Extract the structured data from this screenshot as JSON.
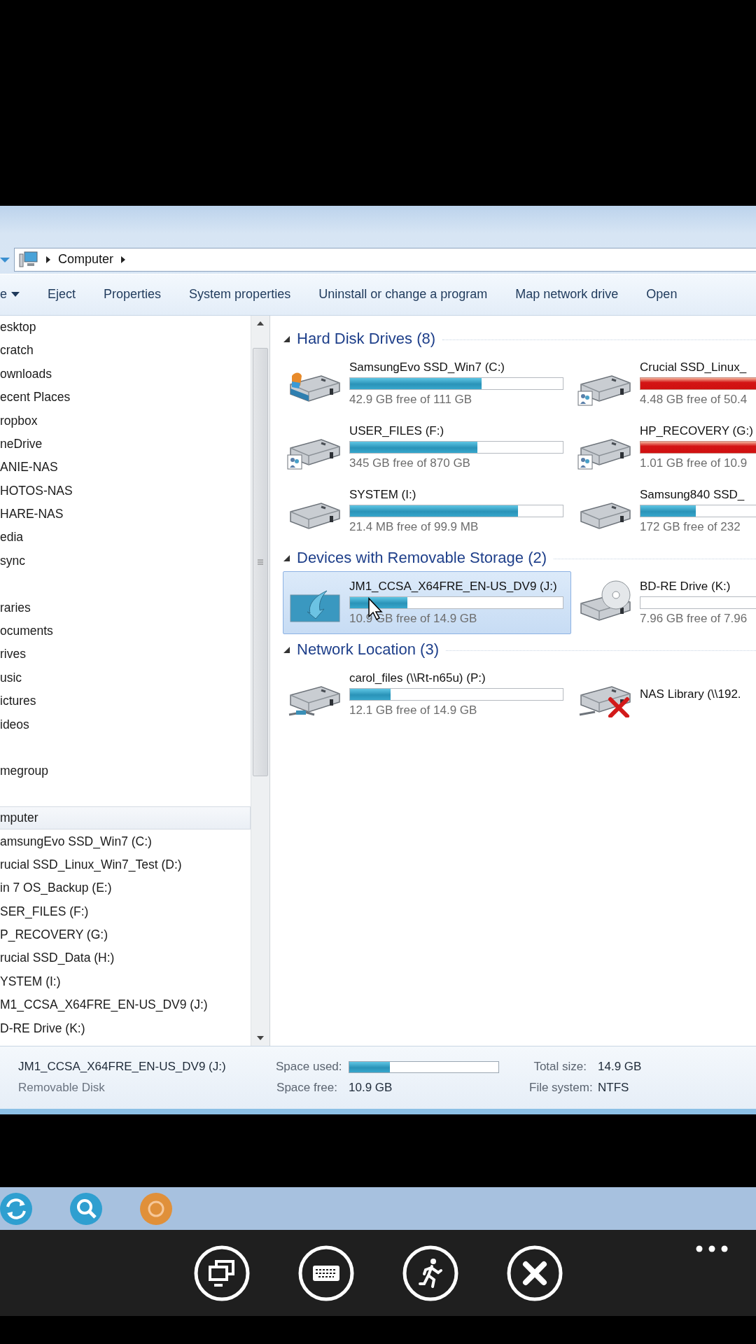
{
  "address_bar": {
    "location": "Computer"
  },
  "toolbar": {
    "items": [
      {
        "label": "e",
        "kind": "menu"
      },
      {
        "label": "Eject",
        "kind": "button"
      },
      {
        "label": "Properties",
        "kind": "button"
      },
      {
        "label": "System properties",
        "kind": "button"
      },
      {
        "label": "Uninstall or change a program",
        "kind": "button"
      },
      {
        "label": "Map network drive",
        "kind": "button"
      },
      {
        "label": "Open",
        "kind": "button"
      }
    ]
  },
  "navigation": {
    "groups": [
      {
        "items": [
          {
            "label": "esktop",
            "selected": false
          },
          {
            "label": "cratch",
            "selected": false
          },
          {
            "label": "ownloads",
            "selected": false
          },
          {
            "label": "ecent Places",
            "selected": false
          },
          {
            "label": "ropbox",
            "selected": false
          },
          {
            "label": "neDrive",
            "selected": false
          },
          {
            "label": "ANIE-NAS",
            "selected": false
          },
          {
            "label": "HOTOS-NAS",
            "selected": false
          },
          {
            "label": "HARE-NAS",
            "selected": false
          },
          {
            "label": "edia",
            "selected": false
          },
          {
            "label": "sync",
            "selected": false
          }
        ]
      },
      {
        "items": [
          {
            "label": "raries",
            "selected": false
          },
          {
            "label": "ocuments",
            "selected": false
          },
          {
            "label": "rives",
            "selected": false
          },
          {
            "label": "usic",
            "selected": false
          },
          {
            "label": "ictures",
            "selected": false
          },
          {
            "label": "ideos",
            "selected": false
          }
        ]
      },
      {
        "items": [
          {
            "label": "megroup",
            "selected": false
          }
        ]
      },
      {
        "items": [
          {
            "label": "mputer",
            "selected": true
          },
          {
            "label": "amsungEvo SSD_Win7 (C:)",
            "selected": false
          },
          {
            "label": "rucial SSD_Linux_Win7_Test (D:)",
            "selected": false
          },
          {
            "label": "in 7 OS_Backup (E:)",
            "selected": false
          },
          {
            "label": "SER_FILES (F:)",
            "selected": false
          },
          {
            "label": "P_RECOVERY (G:)",
            "selected": false
          },
          {
            "label": "rucial SSD_Data (H:)",
            "selected": false
          },
          {
            "label": "YSTEM (I:)",
            "selected": false
          },
          {
            "label": "M1_CCSA_X64FRE_EN-US_DV9 (J:)",
            "selected": false
          },
          {
            "label": "D-RE Drive (K:)",
            "selected": false
          }
        ]
      }
    ]
  },
  "sections": [
    {
      "title": "Hard Disk Drives (8)",
      "expanded": true,
      "drives": [
        {
          "name": "SamsungEvo SSD_Win7 (C:)",
          "kind": "system",
          "level": 0.62,
          "warning": false,
          "free": "42.9 GB free of 111 GB",
          "selected": false
        },
        {
          "name": "Crucial SSD_Linux_",
          "kind": "shared",
          "level": 0.91,
          "warning": true,
          "free": "4.48 GB free of 50.4",
          "selected": false
        },
        {
          "name": "USER_FILES (F:)",
          "kind": "shared",
          "level": 0.6,
          "warning": false,
          "free": "345 GB free of 870 GB",
          "selected": false
        },
        {
          "name": "HP_RECOVERY (G:)",
          "kind": "shared",
          "level": 0.91,
          "warning": true,
          "free": "1.01 GB free of 10.9",
          "selected": false
        },
        {
          "name": "SYSTEM (I:)",
          "kind": "plain",
          "level": 0.79,
          "warning": false,
          "free": "21.4 MB free of 99.9 MB",
          "selected": false
        },
        {
          "name": "Samsung840 SSD_",
          "kind": "plain",
          "level": 0.26,
          "warning": false,
          "free": "172 GB free of 232",
          "selected": false
        }
      ]
    },
    {
      "title": "Devices with Removable Storage (2)",
      "expanded": true,
      "drives": [
        {
          "name": "JM1_CCSA_X64FRE_EN-US_DV9 (J:)",
          "kind": "installer",
          "level": 0.27,
          "warning": false,
          "free": "10.9 GB free of 14.9 GB",
          "selected": true
        },
        {
          "name": "BD-RE Drive (K:)",
          "kind": "disc",
          "level": 0,
          "warning": false,
          "free": "7.96 GB free of 7.96",
          "selected": false
        }
      ]
    },
    {
      "title": "Network Location (3)",
      "expanded": true,
      "drives": [
        {
          "name": "carol_files (\\\\Rt-n65u) (P:)",
          "kind": "network",
          "level": 0.19,
          "warning": false,
          "free": "12.1 GB free of 14.9 GB",
          "selected": false
        },
        {
          "name": "NAS Library (\\\\192.",
          "kind": "offline",
          "selected": false
        }
      ]
    }
  ],
  "details": {
    "name": "JM1_CCSA_X64FRE_EN-US_DV9 (J:)",
    "type": "Removable Disk",
    "space_used_label": "Space used:",
    "level": 0.27,
    "total_size_label": "Total size:",
    "total_size": "14.9 GB",
    "space_free_label": "Space free:",
    "space_free": "10.9 GB",
    "file_system_label": "File system:",
    "file_system": "NTFS"
  }
}
